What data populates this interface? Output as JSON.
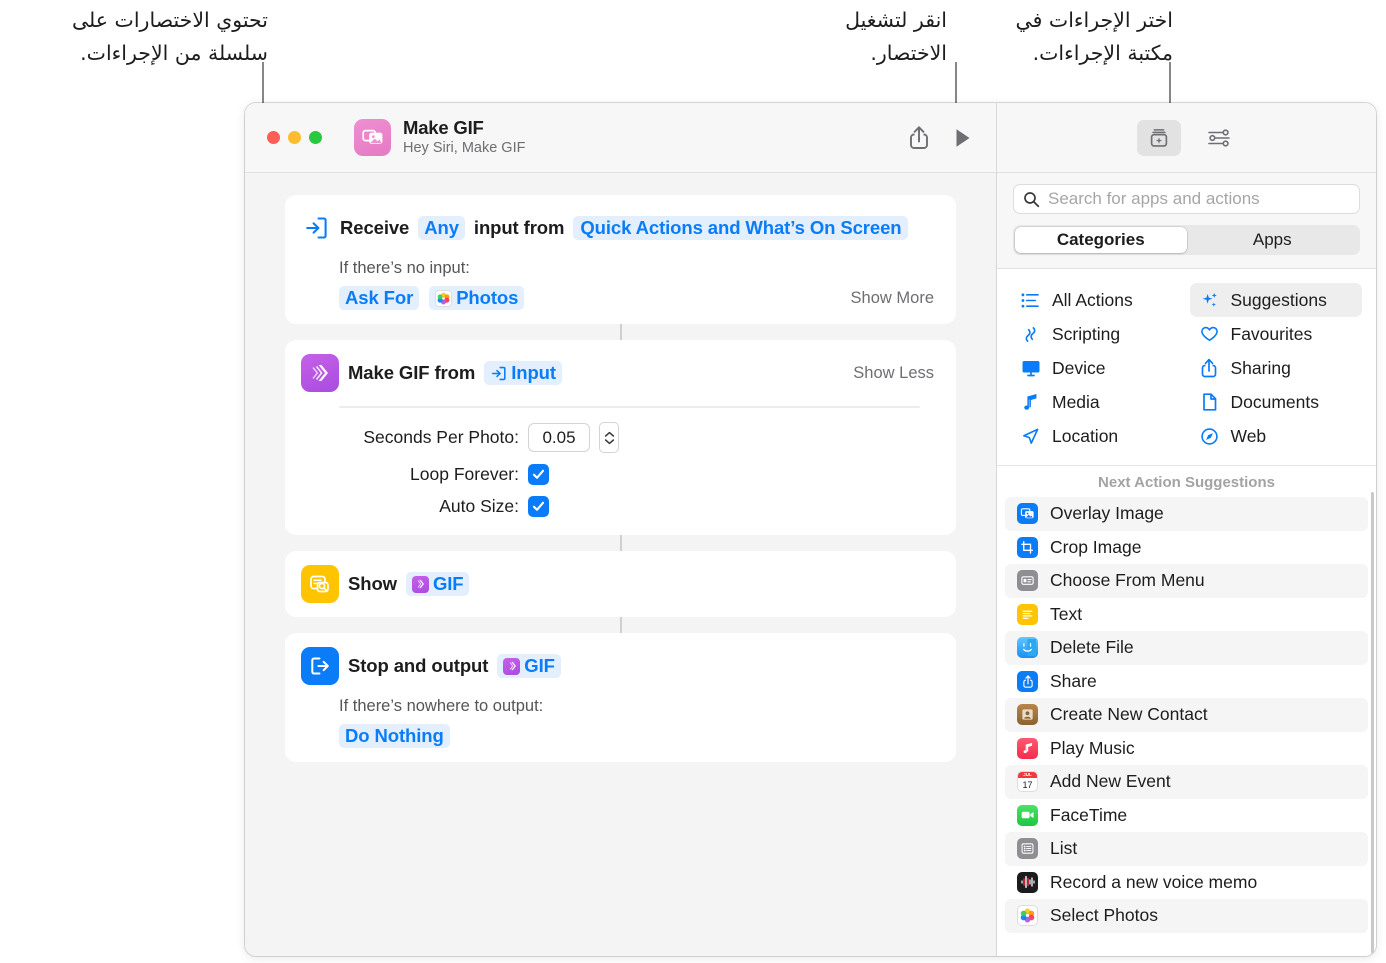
{
  "annotations": {
    "left": "تحتوي الاختصارات على\nسلسلة من الإجراءات.",
    "middle": "انقر لتشغيل\nالاختصار.",
    "right": "اختر الإجراءات في\nمكتبة الإجراءات."
  },
  "window": {
    "title": "Make GIF",
    "subtitle": "Hey Siri, Make GIF",
    "toolbar": {
      "share_icon": "share-icon",
      "run_icon": "play-icon"
    }
  },
  "workflow": {
    "actions": [
      {
        "id": "receive-input",
        "icon": "receive-input-icon",
        "headline_prefix": "Receive",
        "token_any": "Any",
        "headline_mid": "input from",
        "token_source": "Quick Actions and What’s On Screen",
        "sub_label": "If there’s no input:",
        "token_ask_for": "Ask For",
        "token_photos": "Photos",
        "photos_icon": "photos-app-icon",
        "show_toggle": "Show More"
      },
      {
        "id": "make-gif",
        "icon": "make-gif-icon",
        "headline_prefix": "Make GIF from",
        "token_input": "Input",
        "input_icon": "variable-input-icon",
        "show_toggle": "Show Less",
        "params": [
          {
            "label": "Seconds Per Photo:",
            "type": "number",
            "value": "0.05"
          },
          {
            "label": "Loop Forever:",
            "type": "checkbox",
            "checked": true
          },
          {
            "label": "Auto Size:",
            "type": "checkbox",
            "checked": true
          }
        ]
      },
      {
        "id": "show-gif",
        "icon": "quick-look-icon",
        "headline_prefix": "Show",
        "token_gif": "GIF",
        "gif_icon": "gif-variable-icon"
      },
      {
        "id": "stop-and-output",
        "icon": "stop-output-icon",
        "headline_prefix": "Stop and output",
        "token_gif": "GIF",
        "gif_icon": "gif-variable-icon",
        "sub_label": "If there’s nowhere to output:",
        "token_do_nothing": "Do Nothing"
      }
    ]
  },
  "library": {
    "toolbar": {
      "library_button_icon": "action-library-icon",
      "details_button_icon": "sliders-icon"
    },
    "search": {
      "placeholder": "Search for apps and actions",
      "value": "",
      "icon": "search-icon"
    },
    "segmented": {
      "options": [
        "Categories",
        "Apps"
      ],
      "selected": "Categories"
    },
    "categories": [
      {
        "label": "All Actions",
        "icon": "list-bullet-icon",
        "selected": false,
        "color": "#0a7cf7"
      },
      {
        "label": "Suggestions",
        "icon": "sparkles-icon",
        "selected": true,
        "color": "#0a7cf7"
      },
      {
        "label": "Scripting",
        "icon": "scripting-icon",
        "selected": false,
        "color": "#0a7cf7"
      },
      {
        "label": "Favourites",
        "icon": "heart-icon",
        "selected": false,
        "color": "#0a7cf7"
      },
      {
        "label": "Device",
        "icon": "display-icon",
        "selected": false,
        "color": "#0a7cf7"
      },
      {
        "label": "Sharing",
        "icon": "share-icon",
        "selected": false,
        "color": "#0a7cf7"
      },
      {
        "label": "Media",
        "icon": "music-note-icon",
        "selected": false,
        "color": "#0a7cf7"
      },
      {
        "label": "Documents",
        "icon": "document-icon",
        "selected": false,
        "color": "#0a7cf7"
      },
      {
        "label": "Location",
        "icon": "location-arrow-icon",
        "selected": false,
        "color": "#0a7cf7"
      },
      {
        "label": "Web",
        "icon": "safari-compass-icon",
        "selected": false,
        "color": "#0a7cf7"
      }
    ],
    "suggestions_header": "Next Action Suggestions",
    "suggestions": [
      {
        "label": "Overlay Image",
        "icon": "overlay-image-icon",
        "color": "#0a7cf7"
      },
      {
        "label": "Crop Image",
        "icon": "crop-image-icon",
        "color": "#0a7cf7"
      },
      {
        "label": "Choose From Menu",
        "icon": "menu-icon",
        "color": "#8e8e93"
      },
      {
        "label": "Text",
        "icon": "text-icon",
        "color": "#ffc400"
      },
      {
        "label": "Delete File",
        "icon": "finder-icon",
        "color": "#2aa8f2"
      },
      {
        "label": "Share",
        "icon": "share-action-icon",
        "color": "#0a7cf7"
      },
      {
        "label": "Create New Contact",
        "icon": "contacts-icon",
        "color": "#a0763c"
      },
      {
        "label": "Play Music",
        "icon": "music-app-icon",
        "color": "#f93b5b"
      },
      {
        "label": "Add New Event",
        "icon": "calendar-icon",
        "color": "#ffffff"
      },
      {
        "label": "FaceTime",
        "icon": "facetime-icon",
        "color": "#2ecc4a"
      },
      {
        "label": "List",
        "icon": "list-icon",
        "color": "#8e8e93"
      },
      {
        "label": "Record a new voice memo",
        "icon": "voice-memos-icon",
        "color": "#1c1c1e"
      },
      {
        "label": "Select Photos",
        "icon": "photos-app-icon",
        "color": "#ffffff"
      }
    ]
  },
  "colors": {
    "accent": "#0a7cf7",
    "token_bg": "#e3effd",
    "shortcut_pink": "#e47ac4",
    "gif_purple": "#a84ce0",
    "quicklook_yellow": "#ffc400"
  }
}
